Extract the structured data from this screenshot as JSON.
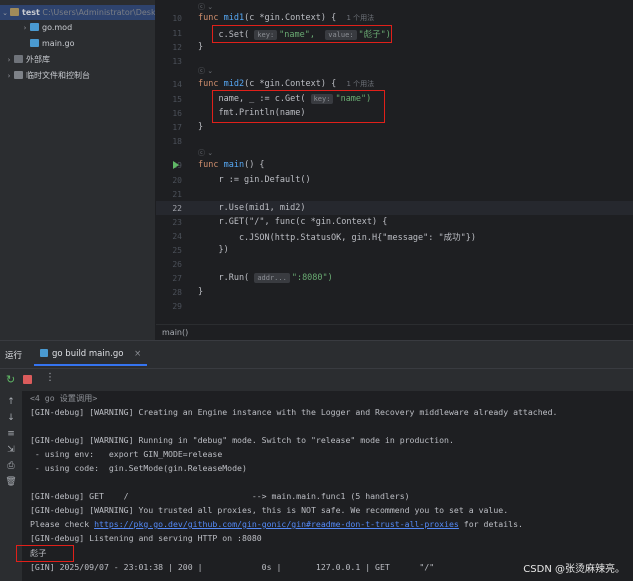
{
  "tree": {
    "root": {
      "name": "test",
      "path": "C:\\Users\\Administrator\\Desk"
    },
    "files": [
      "go.mod",
      "main.go"
    ],
    "external": "外部库",
    "scratches": "临时文件和控制台"
  },
  "editor": {
    "lines": [
      {
        "n": "10",
        "code": "func mid1(c *gin.Context) {",
        "hint": "1 个用法"
      },
      {
        "n": "11",
        "pre": "    c.Set(",
        "p1": "key:",
        "v1": "\"name\",",
        "p2": "value:",
        "v2": "\"彪子\")"
      },
      {
        "n": "12",
        "code": "}"
      },
      {
        "n": "13",
        "code": ""
      },
      {
        "n": "14",
        "code": "func mid2(c *gin.Context) {",
        "hint": "1 个用法"
      },
      {
        "n": "15",
        "pre": "    name, _ := c.Get(",
        "p1": "key:",
        "v1": "\"name\")"
      },
      {
        "n": "16",
        "code": "    fmt.Println(name)"
      },
      {
        "n": "17",
        "code": "}"
      },
      {
        "n": "18",
        "code": ""
      },
      {
        "n": "19",
        "code": "func main() {"
      },
      {
        "n": "20",
        "code": "    r := gin.Default()"
      },
      {
        "n": "21",
        "code": ""
      },
      {
        "n": "22",
        "code": "    r.Use(mid1, mid2)"
      },
      {
        "n": "23",
        "code": "    r.GET(\"/\", func(c *gin.Context) {"
      },
      {
        "n": "24",
        "code": "        c.JSON(http.StatusOK, gin.H{\"message\": \"成功\"})"
      },
      {
        "n": "25",
        "code": "    })"
      },
      {
        "n": "26",
        "code": ""
      },
      {
        "n": "27",
        "pre": "    r.Run(",
        "p1": "addr...",
        "v1": "\":8080\")"
      },
      {
        "n": "28",
        "code": "}"
      },
      {
        "n": "29",
        "code": ""
      }
    ],
    "breadcrumb": "main()",
    "fold_hint": "ⓒ ⌄"
  },
  "run": {
    "tab_title": "运行",
    "config_tab": "go build main.go",
    "cmd": "<4 go 设置调用>",
    "console": [
      "[GIN-debug] [WARNING] Creating an Engine instance with the Logger and Recovery middleware already attached.",
      "",
      "[GIN-debug] [WARNING] Running in \"debug\" mode. Switch to \"release\" mode in production.",
      " - using env:   export GIN_MODE=release",
      " - using code:  gin.SetMode(gin.ReleaseMode)",
      "",
      "[GIN-debug] GET    /                         --> main.main.func1 (5 handlers)",
      "[GIN-debug] [WARNING] You trusted all proxies, this is NOT safe. We recommend you to set a value.",
      "",
      "[GIN-debug] Listening and serving HTTP on :8080",
      "彪子",
      "[GIN] 2025/09/07 - 23:01:38 | 200 |            0s |       127.0.0.1 | GET      \"/\""
    ],
    "please_check": "Please check ",
    "link": "https://pkg.go.dev/github.com/gin-gonic/gin#readme-don-t-trust-all-proxies",
    "for_details": " for details."
  },
  "watermark": "CSDN @张烫麻辣亮。"
}
